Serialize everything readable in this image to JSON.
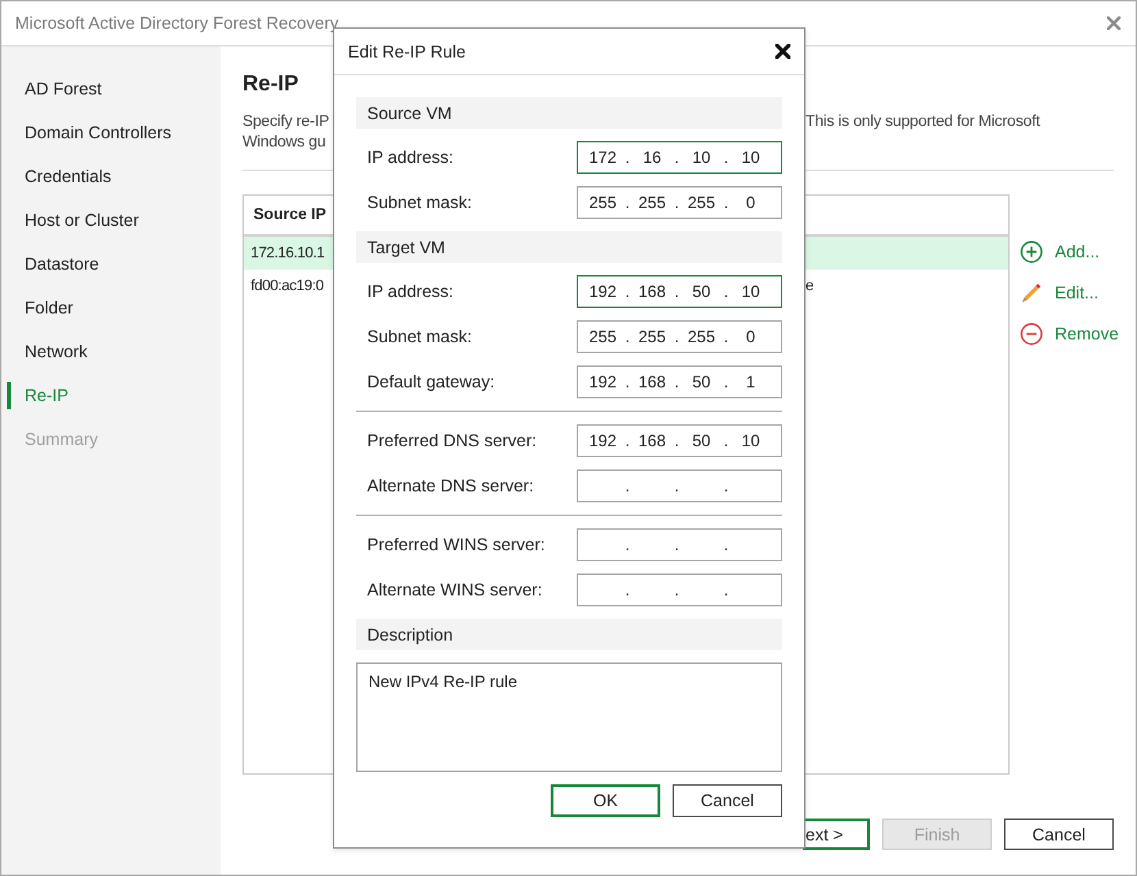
{
  "window": {
    "title": "Microsoft Active Directory Forest Recovery"
  },
  "sidebar": {
    "items": [
      {
        "label": "AD Forest",
        "selected": false,
        "disabled": false
      },
      {
        "label": "Domain Controllers",
        "selected": false,
        "disabled": false
      },
      {
        "label": "Credentials",
        "selected": false,
        "disabled": false
      },
      {
        "label": "Host or Cluster",
        "selected": false,
        "disabled": false
      },
      {
        "label": "Datastore",
        "selected": false,
        "disabled": false
      },
      {
        "label": "Folder",
        "selected": false,
        "disabled": false
      },
      {
        "label": "Network",
        "selected": false,
        "disabled": false
      },
      {
        "label": "Re-IP",
        "selected": true,
        "disabled": false
      },
      {
        "label": "Summary",
        "selected": false,
        "disabled": true
      }
    ]
  },
  "page": {
    "heading": "Re-IP",
    "description_lines": [
      {
        "left_part": "Specify re-IP",
        "right_part": "This is only supported for Microsoft"
      },
      {
        "left_part": "Windows gu"
      }
    ]
  },
  "table": {
    "columns": [
      "Source IP"
    ],
    "rows": [
      {
        "left_part": "172.16.10.1",
        "selected": true
      },
      {
        "left_part": "fd00:ac19:0",
        "right_part": "e",
        "selected": false
      }
    ]
  },
  "actions": [
    {
      "label": "Add...",
      "kind": "add"
    },
    {
      "label": "Edit...",
      "kind": "edit"
    },
    {
      "label": "Remove",
      "kind": "remove"
    }
  ],
  "footer": {
    "buttons": [
      {
        "label": "ext >",
        "default": true,
        "disabled": false
      },
      {
        "label": "Finish",
        "default": false,
        "disabled": true
      },
      {
        "label": "Cancel",
        "default": false,
        "disabled": false
      }
    ]
  },
  "dialog": {
    "title": "Edit Re-IP Rule",
    "sections": [
      {
        "title": "Source VM",
        "groups": [
          {
            "rows": [
              {
                "label": "IP address:",
                "value": "172 . 16 . 10 . 10",
                "highlighted": true
              },
              {
                "label": "Subnet mask:",
                "value": "255 . 255 . 255 . 0",
                "highlighted": false
              }
            ]
          }
        ]
      },
      {
        "title": "Target VM",
        "groups": [
          {
            "rows": [
              {
                "label": "IP address:",
                "value": "192 . 168 . 50 . 10",
                "highlighted": true
              },
              {
                "label": "Subnet mask:",
                "value": "255 . 255 . 255 . 0",
                "highlighted": false
              },
              {
                "label": "Default gateway:",
                "value": "192 . 168 . 50 . 1",
                "highlighted": false
              }
            ]
          },
          {
            "rows": [
              {
                "label": "Preferred DNS server:",
                "value": "192 . 168 . 50 . 10",
                "highlighted": false
              },
              {
                "label": "Alternate DNS server:",
                "value": ". . .",
                "highlighted": false
              }
            ]
          },
          {
            "rows": [
              {
                "label": "Preferred WINS server:",
                "value": ". . .",
                "highlighted": false
              },
              {
                "label": "Alternate WINS server:",
                "value": ". . .",
                "highlighted": false
              }
            ]
          }
        ]
      }
    ],
    "description": {
      "title": "Description",
      "value": "New IPv4 Re-IP rule"
    },
    "buttons": [
      {
        "label": "OK",
        "default": true
      },
      {
        "label": "Cancel",
        "default": false
      }
    ]
  }
}
